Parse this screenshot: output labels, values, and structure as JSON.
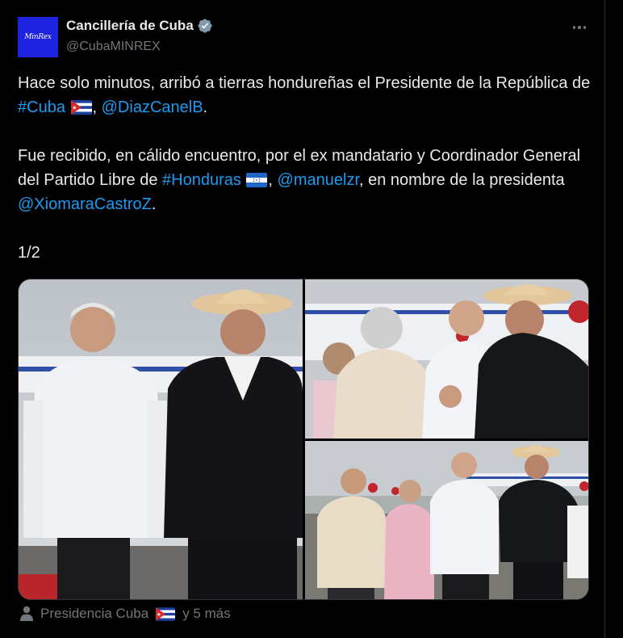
{
  "account": {
    "avatar_text": "MinRex",
    "display_name": "Cancillería de Cuba",
    "handle": "@CubaMINREX",
    "verified_color": "#829aab"
  },
  "tweet": {
    "p1_a": "Hace solo minutos, arribó a tierras hondureñas el Presidente de la República de ",
    "p1_hashtag": "#Cuba",
    "p1_sep": ", ",
    "p1_mention": "@DiazCanelB",
    "p1_end": ".",
    "p2_a": "Fue recibido, en cálido encuentro, por el ex mandatario y Coordinador General del Partido Libre de ",
    "p2_hashtag": "#Honduras",
    "p2_sep": ", ",
    "p2_mention1": "@manuelzr",
    "p2_b": ", en nombre de la presidenta ",
    "p2_mention2": "@XiomaraCastroZ",
    "p2_end": ".",
    "p3": "1/2"
  },
  "tagged": {
    "text_a": "Presidencia Cuba",
    "text_b": "y 5 más"
  },
  "colors": {
    "link": "#1d9bf0",
    "text": "#e7e9ea",
    "muted": "#71767b",
    "background": "#000000"
  },
  "icons": {
    "more": "more-horizontal-icon",
    "verified": "verified-badge-icon",
    "person": "person-icon",
    "flag_cuba": "cuba-flag-icon",
    "flag_honduras": "honduras-flag-icon"
  }
}
